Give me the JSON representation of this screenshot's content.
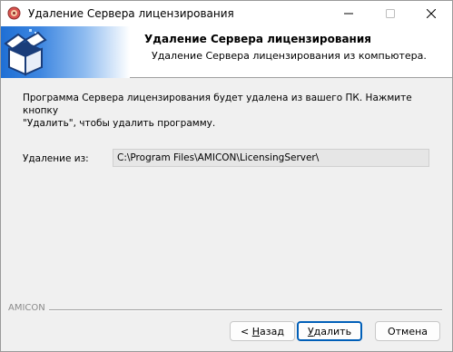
{
  "window": {
    "title": "Удаление Сервера лицензирования"
  },
  "header": {
    "title": "Удаление Сервера лицензирования",
    "subtitle": "Удаление Сервера лицензирования из компьютера."
  },
  "body": {
    "description_line1": "Программа Сервера лицензирования будет удалена из вашего ПК. Нажмите кнопку",
    "description_line2": "\"Удалить\", чтобы удалить программу.",
    "path_label": "Удаление из:",
    "path_value": "C:\\Program Files\\AMICON\\LicensingServer\\"
  },
  "footer": {
    "brand": "AMICON",
    "back_prefix": "< ",
    "back_mnemonic": "Н",
    "back_rest": "азад",
    "remove_mnemonic": "У",
    "remove_rest": "далить",
    "cancel_label": "Отмена"
  },
  "icons": {
    "app": "installer-app-icon",
    "banner": "open-box-icon",
    "minimize": "minimize-icon",
    "maximize": "maximize-icon",
    "close": "close-icon"
  },
  "colors": {
    "accent": "#005fb8",
    "banner_blue": "#1f6fd4"
  }
}
